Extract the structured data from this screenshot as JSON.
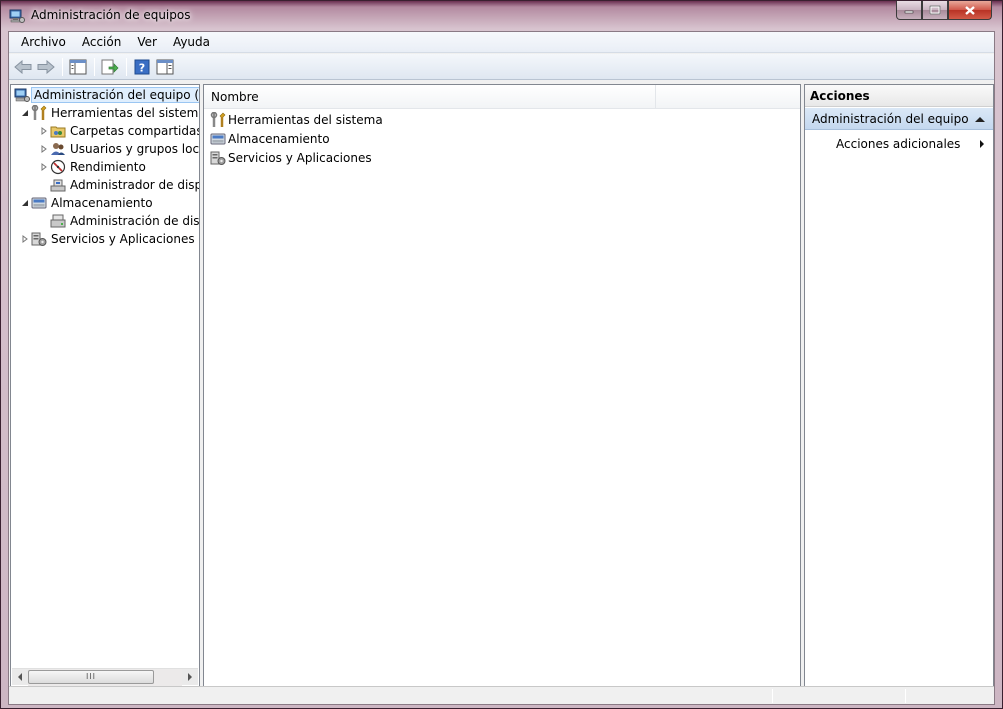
{
  "window": {
    "title": "Administración de equipos",
    "accent": "#7a2a55"
  },
  "menubar": {
    "items": [
      "Archivo",
      "Acción",
      "Ver",
      "Ayuda"
    ]
  },
  "toolbar": {
    "buttons": [
      {
        "icon": "back-arrow-icon",
        "enabled": false
      },
      {
        "icon": "forward-arrow-icon",
        "enabled": false
      },
      {
        "icon": "show-hide-console-tree-icon",
        "enabled": true
      },
      {
        "icon": "export-list-icon",
        "enabled": true
      },
      {
        "icon": "help-icon",
        "enabled": true
      },
      {
        "icon": "show-hide-action-pane-icon",
        "enabled": true
      }
    ]
  },
  "tree": {
    "items": [
      {
        "label": "Administración del equipo (local)",
        "icon": "computer-management-icon",
        "level": 0,
        "expander": "",
        "selected": true
      },
      {
        "label": "Herramientas del sistema",
        "icon": "tools-icon",
        "level": 1,
        "expander": "expanded"
      },
      {
        "label": "Carpetas compartidas",
        "icon": "shared-folder-icon",
        "level": 2,
        "expander": "collapsed"
      },
      {
        "label": "Usuarios y grupos locales",
        "icon": "users-icon",
        "level": 2,
        "expander": "collapsed"
      },
      {
        "label": "Rendimiento",
        "icon": "performance-icon",
        "level": 2,
        "expander": "collapsed"
      },
      {
        "label": "Administrador de dispositivos",
        "icon": "device-manager-icon",
        "level": 2,
        "expander": ""
      },
      {
        "label": "Almacenamiento",
        "icon": "storage-icon",
        "level": 1,
        "expander": "expanded"
      },
      {
        "label": "Administración de discos",
        "icon": "disk-management-icon",
        "level": 2,
        "expander": ""
      },
      {
        "label": "Servicios y Aplicaciones",
        "icon": "services-icon",
        "level": 1,
        "expander": "collapsed"
      }
    ]
  },
  "list": {
    "column_header": "Nombre",
    "rows": [
      {
        "label": "Herramientas del sistema",
        "icon": "tools-icon"
      },
      {
        "label": "Almacenamiento",
        "icon": "storage-icon"
      },
      {
        "label": "Servicios y Aplicaciones",
        "icon": "services-icon"
      }
    ]
  },
  "actions": {
    "header": "Acciones",
    "section": "Administración del equipo (...",
    "items": [
      {
        "label": "Acciones adicionales"
      }
    ]
  },
  "scrollbar": {
    "grip": "III"
  }
}
